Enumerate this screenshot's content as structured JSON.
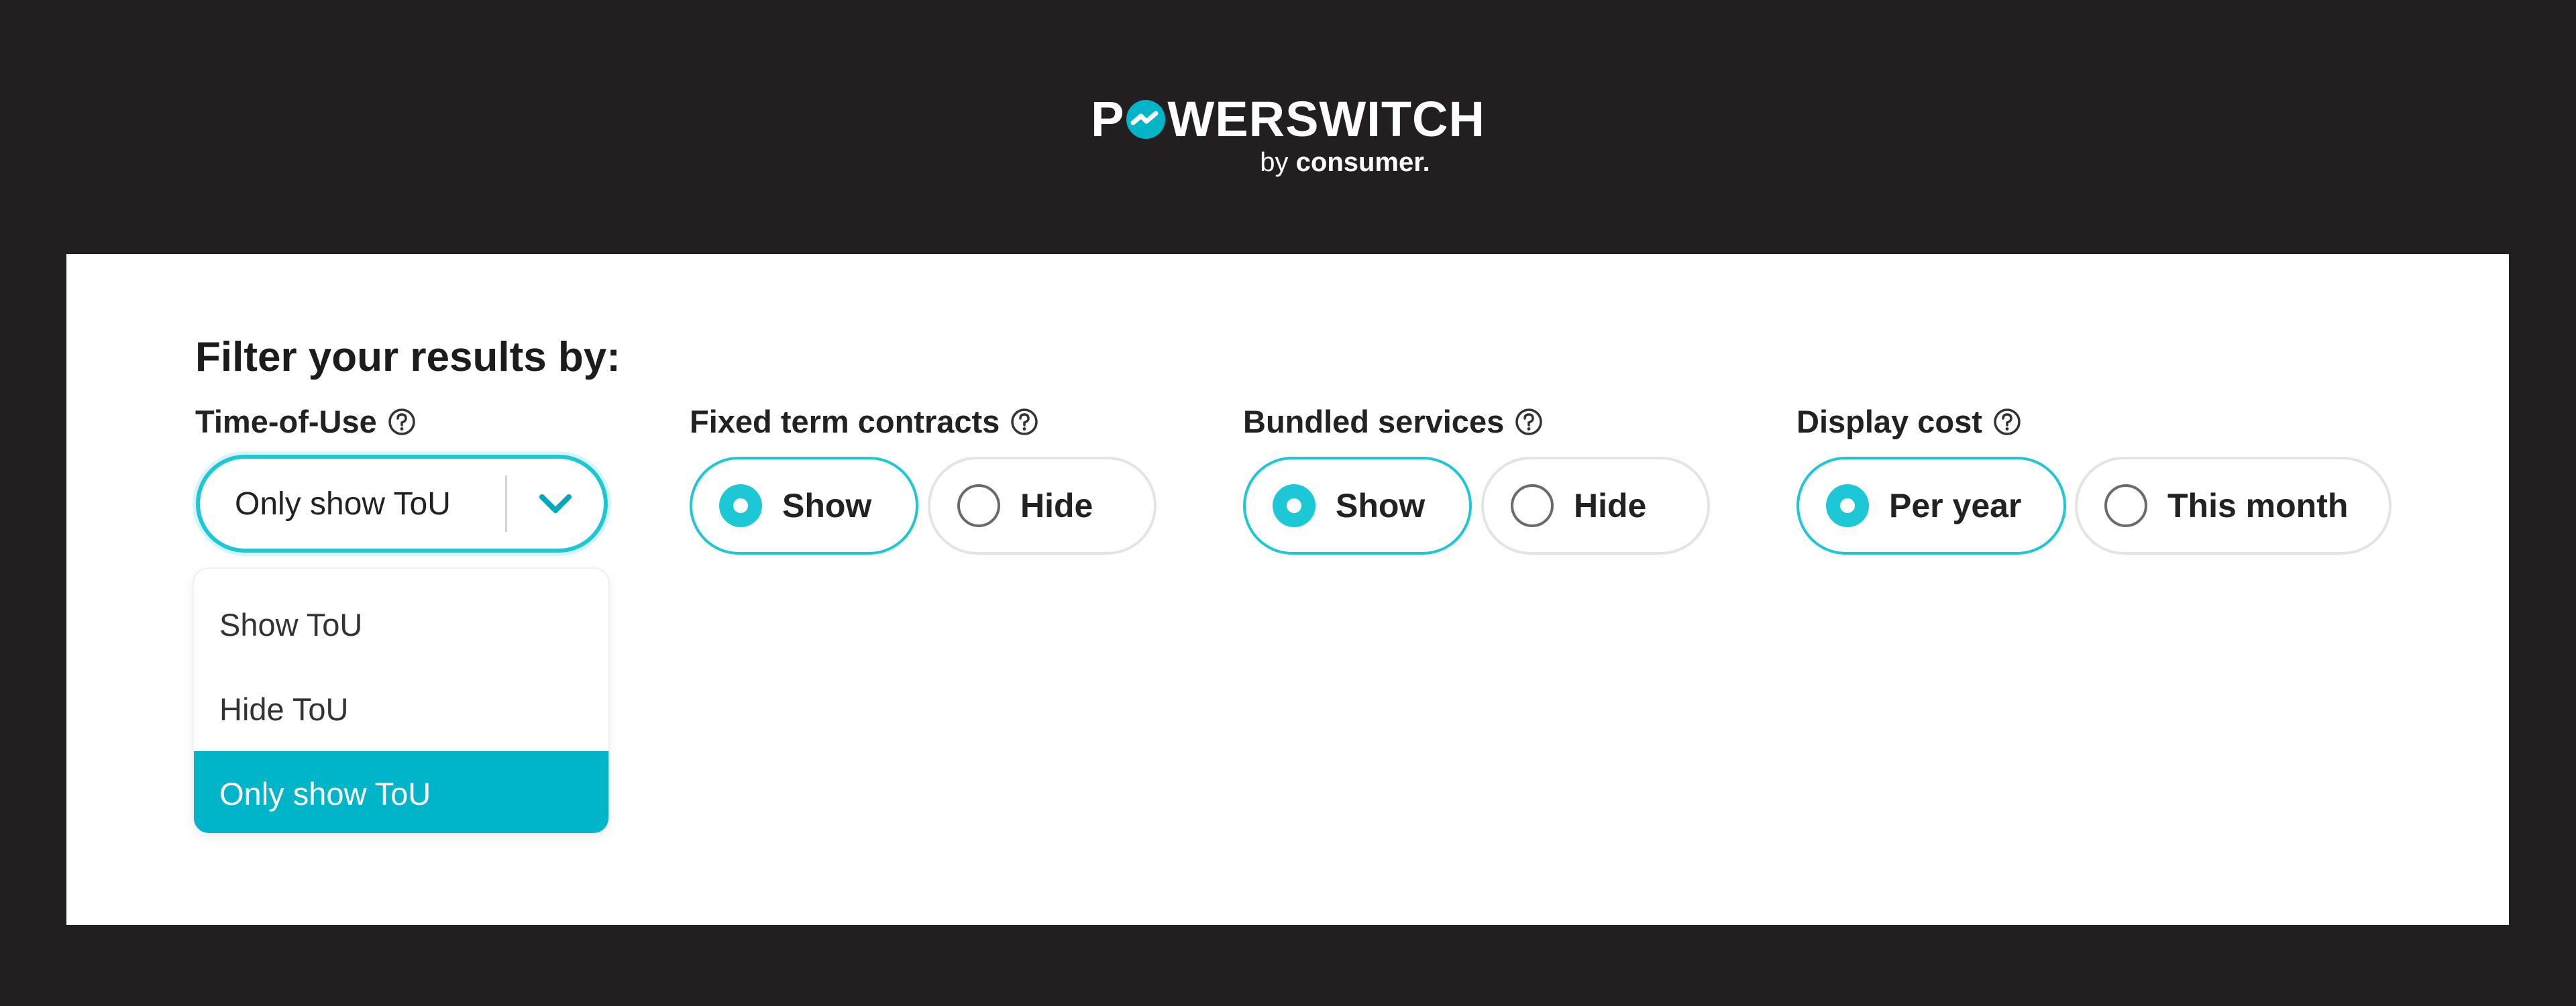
{
  "brand": {
    "name_before_o": "P",
    "name_after_o": "WERSWITCH",
    "sub_prefix": "by ",
    "sub_bold": "consumer.",
    "accent_color": "#00b5c8"
  },
  "filters": {
    "heading": "Filter your results by:",
    "time_of_use": {
      "label": "Time-of-Use",
      "help_icon": "question-circle-icon",
      "selected_value": "Only show ToU",
      "options": [
        "Show ToU",
        "Hide ToU",
        "Only show ToU"
      ],
      "expanded": true
    },
    "fixed_term": {
      "label": "Fixed term contracts",
      "help_icon": "question-circle-icon",
      "options": [
        {
          "label": "Show",
          "checked": true
        },
        {
          "label": "Hide",
          "checked": false
        }
      ]
    },
    "bundled": {
      "label": "Bundled services",
      "help_icon": "question-circle-icon",
      "options": [
        {
          "label": "Show",
          "checked": true
        },
        {
          "label": "Hide",
          "checked": false
        }
      ]
    },
    "display_cost": {
      "label": "Display cost",
      "help_icon": "question-circle-icon",
      "options": [
        {
          "label": "Per year",
          "checked": true
        },
        {
          "label": "This month",
          "checked": false
        }
      ]
    }
  }
}
